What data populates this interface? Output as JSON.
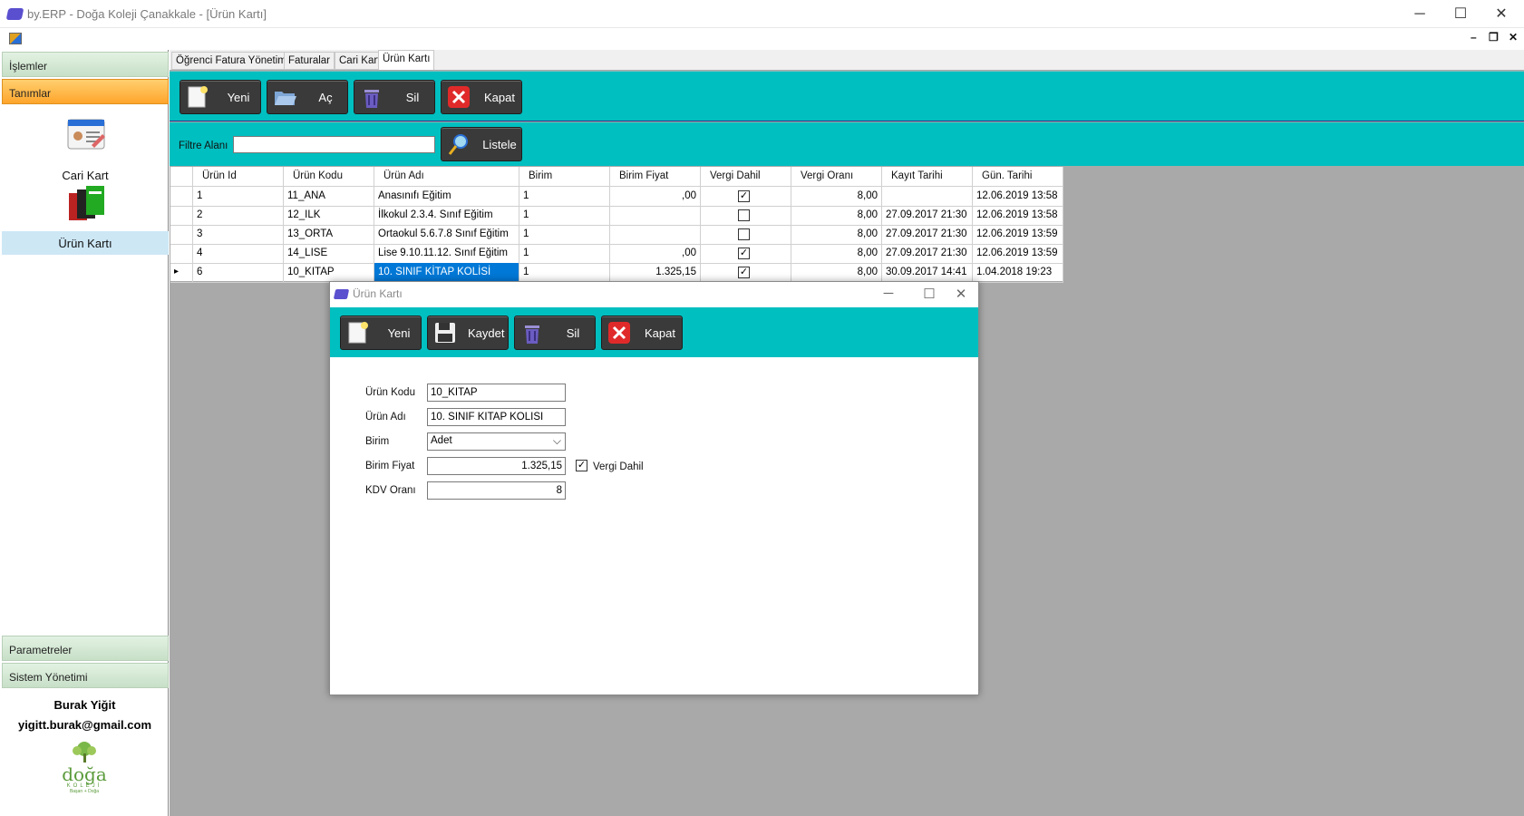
{
  "window": {
    "title": "by.ERP - Doğa Koleji Çanakkale - [Ürün Kartı]"
  },
  "sidebar": {
    "sections": [
      {
        "label": "İşlemler"
      },
      {
        "label": "Tanımlar"
      },
      {
        "label": "Parametreler"
      },
      {
        "label": "Sistem Yönetimi"
      }
    ],
    "items": [
      {
        "label": "Cari Kart",
        "icon": "address-card-icon"
      },
      {
        "label": "Ürün Kartı",
        "icon": "product-boxes-icon"
      }
    ],
    "user_name": "Burak Yiğit",
    "user_email": "yigitt.burak@gmail.com",
    "logo_text": "doğa",
    "logo_sub": "KOLEJİ",
    "logo_tag": "Başarı + Doğa"
  },
  "tabs": [
    "Öğrenci Fatura Yönetimi",
    "Faturalar",
    "Cari Kart",
    "Ürün Kartı"
  ],
  "toolbar": {
    "new": "Yeni",
    "open": "Aç",
    "delete": "Sil",
    "close": "Kapat"
  },
  "filter": {
    "label": "Filtre Alanı",
    "value": "",
    "list_button": "Listele"
  },
  "grid": {
    "columns": [
      "Ürün Id",
      "Ürün Kodu",
      "Ürün Adı",
      "Birim",
      "Birim Fiyat",
      "Vergi Dahil",
      "Vergi Oranı",
      "Kayıt Tarihi",
      "Gün. Tarihi"
    ],
    "rows": [
      {
        "id": "1",
        "code": "11_ANA",
        "name": "Anasınıfı Eğitim",
        "unit": "1",
        "price": ",00",
        "vat_included": true,
        "vat_rate": "8,00",
        "created": "",
        "updated": "12.06.2019 13:58"
      },
      {
        "id": "2",
        "code": "12_ILK",
        "name": "İlkokul 2.3.4. Sınıf Eğitim",
        "unit": "1",
        "price": "",
        "vat_included": false,
        "vat_rate": "8,00",
        "created": "27.09.2017 21:30",
        "updated": "12.06.2019 13:58"
      },
      {
        "id": "3",
        "code": "13_ORTA",
        "name": "Ortaokul 5.6.7.8 Sınıf Eğitim",
        "unit": "1",
        "price": "",
        "vat_included": false,
        "vat_rate": "8,00",
        "created": "27.09.2017 21:30",
        "updated": "12.06.2019 13:59"
      },
      {
        "id": "4",
        "code": "14_LISE",
        "name": "Lise 9.10.11.12. Sınıf Eğitim",
        "unit": "1",
        "price": ",00",
        "vat_included": true,
        "vat_rate": "8,00",
        "created": "27.09.2017 21:30",
        "updated": "12.06.2019 13:59"
      },
      {
        "id": "6",
        "code": "10_KITAP",
        "name": "10. SINIF KİTAP KOLİSİ",
        "unit": "1",
        "price": "1.325,15",
        "vat_included": true,
        "vat_rate": "8,00",
        "created": "30.09.2017 14:41",
        "updated": "1.04.2018 19:23",
        "selected": true
      }
    ]
  },
  "dialog": {
    "title": "Ürün Kartı",
    "toolbar": {
      "new": "Yeni",
      "save": "Kaydet",
      "delete": "Sil",
      "close": "Kapat"
    },
    "form": {
      "code_label": "Ürün Kodu",
      "code_value": "10_KITAP",
      "name_label": "Ürün Adı",
      "name_value": "10. SINIF KİTAP KOLİSİ",
      "unit_label": "Birim",
      "unit_value": "Adet",
      "price_label": "Birim Fiyat",
      "price_value": "1.325,15",
      "vat_included_label": "Vergi Dahil",
      "vat_included": true,
      "vat_rate_label": "KDV Oranı",
      "vat_rate_value": "8"
    }
  },
  "colors": {
    "accent": "#00bfc0",
    "selection": "#0078d7",
    "active_nav": "#ffa52c",
    "workspace": "#a9a9a9"
  }
}
